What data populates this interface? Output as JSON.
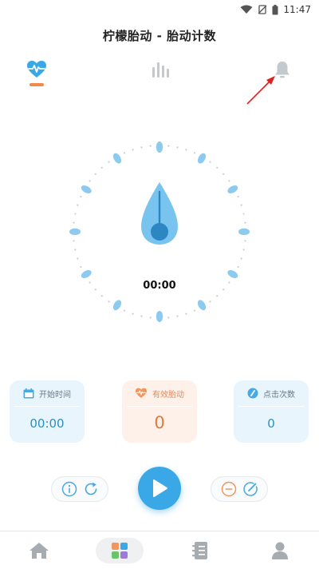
{
  "status_bar": {
    "time": "11:47"
  },
  "app_title": "柠檬胎动 - 胎动计数",
  "tabs": [
    {
      "icon": "heartbeat-icon",
      "active": true
    },
    {
      "icon": "bar-chart-icon",
      "active": false
    },
    {
      "icon": "bell-icon",
      "active": false
    }
  ],
  "timer": {
    "display": "00:00"
  },
  "cards": {
    "start_time": {
      "label": "开始时间",
      "value": "00:00"
    },
    "effective": {
      "label": "有效胎动",
      "value": "0"
    },
    "clicks": {
      "label": "点击次数",
      "value": "0"
    }
  },
  "controls": {
    "left": [
      "info-icon",
      "refresh-icon"
    ],
    "center": "play-icon",
    "right": [
      "minus-icon",
      "edit-icon"
    ]
  },
  "bottom_nav": [
    "home-icon",
    "grid-icon",
    "records-icon",
    "profile-icon"
  ],
  "colors": {
    "accent_blue": "#3aa8e6",
    "accent_orange": "#f08a4b",
    "annotation_red": "#e02020",
    "dial_marker": "#8ccaf0"
  }
}
